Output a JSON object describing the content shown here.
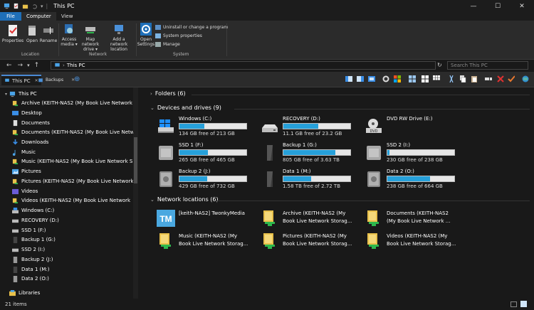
{
  "window": {
    "title": "This PC",
    "controls": [
      "minimize-icon",
      "maximize-icon",
      "close-icon"
    ]
  },
  "ribbon_tabs": [
    "File",
    "Computer",
    "View"
  ],
  "ribbon": {
    "location": {
      "group": "Location",
      "buttons": [
        "Properties",
        "Open",
        "Rename"
      ]
    },
    "network": {
      "group": "Network",
      "buttons": [
        {
          "l1": "Access",
          "l2": "media ▾"
        },
        {
          "l1": "Map network",
          "l2": "drive ▾"
        },
        {
          "l1": "Add a network",
          "l2": "location"
        }
      ]
    },
    "system": {
      "group": "System",
      "open_settings": {
        "l1": "Open",
        "l2": "Settings"
      },
      "commands": [
        "Uninstall or change a program",
        "System properties",
        "Manage"
      ]
    }
  },
  "address": {
    "path": "This PC",
    "search_placeholder": "Search This PC"
  },
  "tabs": [
    "This PC",
    "Backups"
  ],
  "sidebar": [
    {
      "label": "This PC",
      "icon": "pc-icon"
    },
    {
      "label": "Archive (KEITH-NAS2 (My Book Live Network",
      "icon": "network-folder-icon"
    },
    {
      "label": "Desktop",
      "icon": "desktop-icon"
    },
    {
      "label": "Documents",
      "icon": "documents-icon"
    },
    {
      "label": "Documents (KEITH-NAS2 (My Book Live Netw",
      "icon": "network-folder-icon"
    },
    {
      "label": "Downloads",
      "icon": "downloads-icon"
    },
    {
      "label": "Music",
      "icon": "music-icon"
    },
    {
      "label": "Music (KEITH-NAS2 (My Book Live Network S",
      "icon": "network-folder-icon"
    },
    {
      "label": "Pictures",
      "icon": "pictures-icon"
    },
    {
      "label": "Pictures (KEITH-NAS2 (My Book Live Network",
      "icon": "network-folder-icon"
    },
    {
      "label": "Videos",
      "icon": "videos-icon"
    },
    {
      "label": "Videos (KEITH-NAS2 (My Book Live Network",
      "icon": "network-folder-icon"
    },
    {
      "label": "Windows (C:)",
      "icon": "windows-drive-icon"
    },
    {
      "label": "RECOVERY (D:)",
      "icon": "drive-icon"
    },
    {
      "label": "SSD 1 (F:)",
      "icon": "drive-icon"
    },
    {
      "label": "Backup 1 (G:)",
      "icon": "drive-icon"
    },
    {
      "label": "SSD 2 (I:)",
      "icon": "drive-icon"
    },
    {
      "label": "Backup 2 (J:)",
      "icon": "drive-icon"
    },
    {
      "label": "Data 1 (M:)",
      "icon": "drive-icon"
    },
    {
      "label": "Data 2 (O:)",
      "icon": "drive-icon"
    },
    {
      "label": "Libraries",
      "icon": "libraries-icon"
    }
  ],
  "folders_header": "Folders (6)",
  "drives_header": "Devices and drives (9)",
  "drives": [
    {
      "name": "Windows (C:)",
      "free": "134 GB free of 213 GB",
      "used": 0.37,
      "icon": "windows-drive-icon"
    },
    {
      "name": "RECOVERY (D:)",
      "free": "11.1 GB free of 23.2 GB",
      "used": 0.52,
      "icon": "hdd-icon"
    },
    {
      "name": "DVD RW Drive (E:)",
      "free": "",
      "used": null,
      "icon": "dvd-drive-icon"
    },
    {
      "name": "SSD 1 (F:)",
      "free": "265 GB free of 465 GB",
      "used": 0.43,
      "icon": "ssd-icon"
    },
    {
      "name": "Backup 1 (G:)",
      "free": "805 GB free of 3.63 TB",
      "used": 0.78,
      "icon": "external-drive-icon"
    },
    {
      "name": "SSD 2 (I:)",
      "free": "230 GB free of 238 GB",
      "used": 0.03,
      "icon": "ssd-icon"
    },
    {
      "name": "Backup 2 (J:)",
      "free": "429 GB free of 732 GB",
      "used": 0.41,
      "icon": "backup-drive-icon"
    },
    {
      "name": "Data 1 (M:)",
      "free": "1.58 TB free of 2.72 TB",
      "used": 0.42,
      "icon": "external-drive-icon"
    },
    {
      "name": "Data 2 (O:)",
      "free": "238 GB free of 664 GB",
      "used": 0.64,
      "icon": "backup-drive-icon"
    }
  ],
  "network_header": "Network locations (6)",
  "network": [
    {
      "l1": "[keith-NAS2] TwonkyMedia",
      "l2": "",
      "icon": "media-server-icon"
    },
    {
      "l1": "Archive (KEITH-NAS2 (My",
      "l2": "Book Live Network Storag...",
      "icon": "network-folder-icon"
    },
    {
      "l1": "Documents (KEITH-NAS2",
      "l2": "(My Book Live Network ...",
      "icon": "network-folder-icon"
    },
    {
      "l1": "Music (KEITH-NAS2 (My",
      "l2": "Book Live Network Storag...",
      "icon": "network-folder-icon"
    },
    {
      "l1": "Pictures (KEITH-NAS2 (My",
      "l2": "Book Live Network Storag...",
      "icon": "network-folder-icon"
    },
    {
      "l1": "Videos (KEITH-NAS2 (My",
      "l2": "Book Live Network Storag...",
      "icon": "network-folder-icon"
    }
  ],
  "status": "21 items"
}
